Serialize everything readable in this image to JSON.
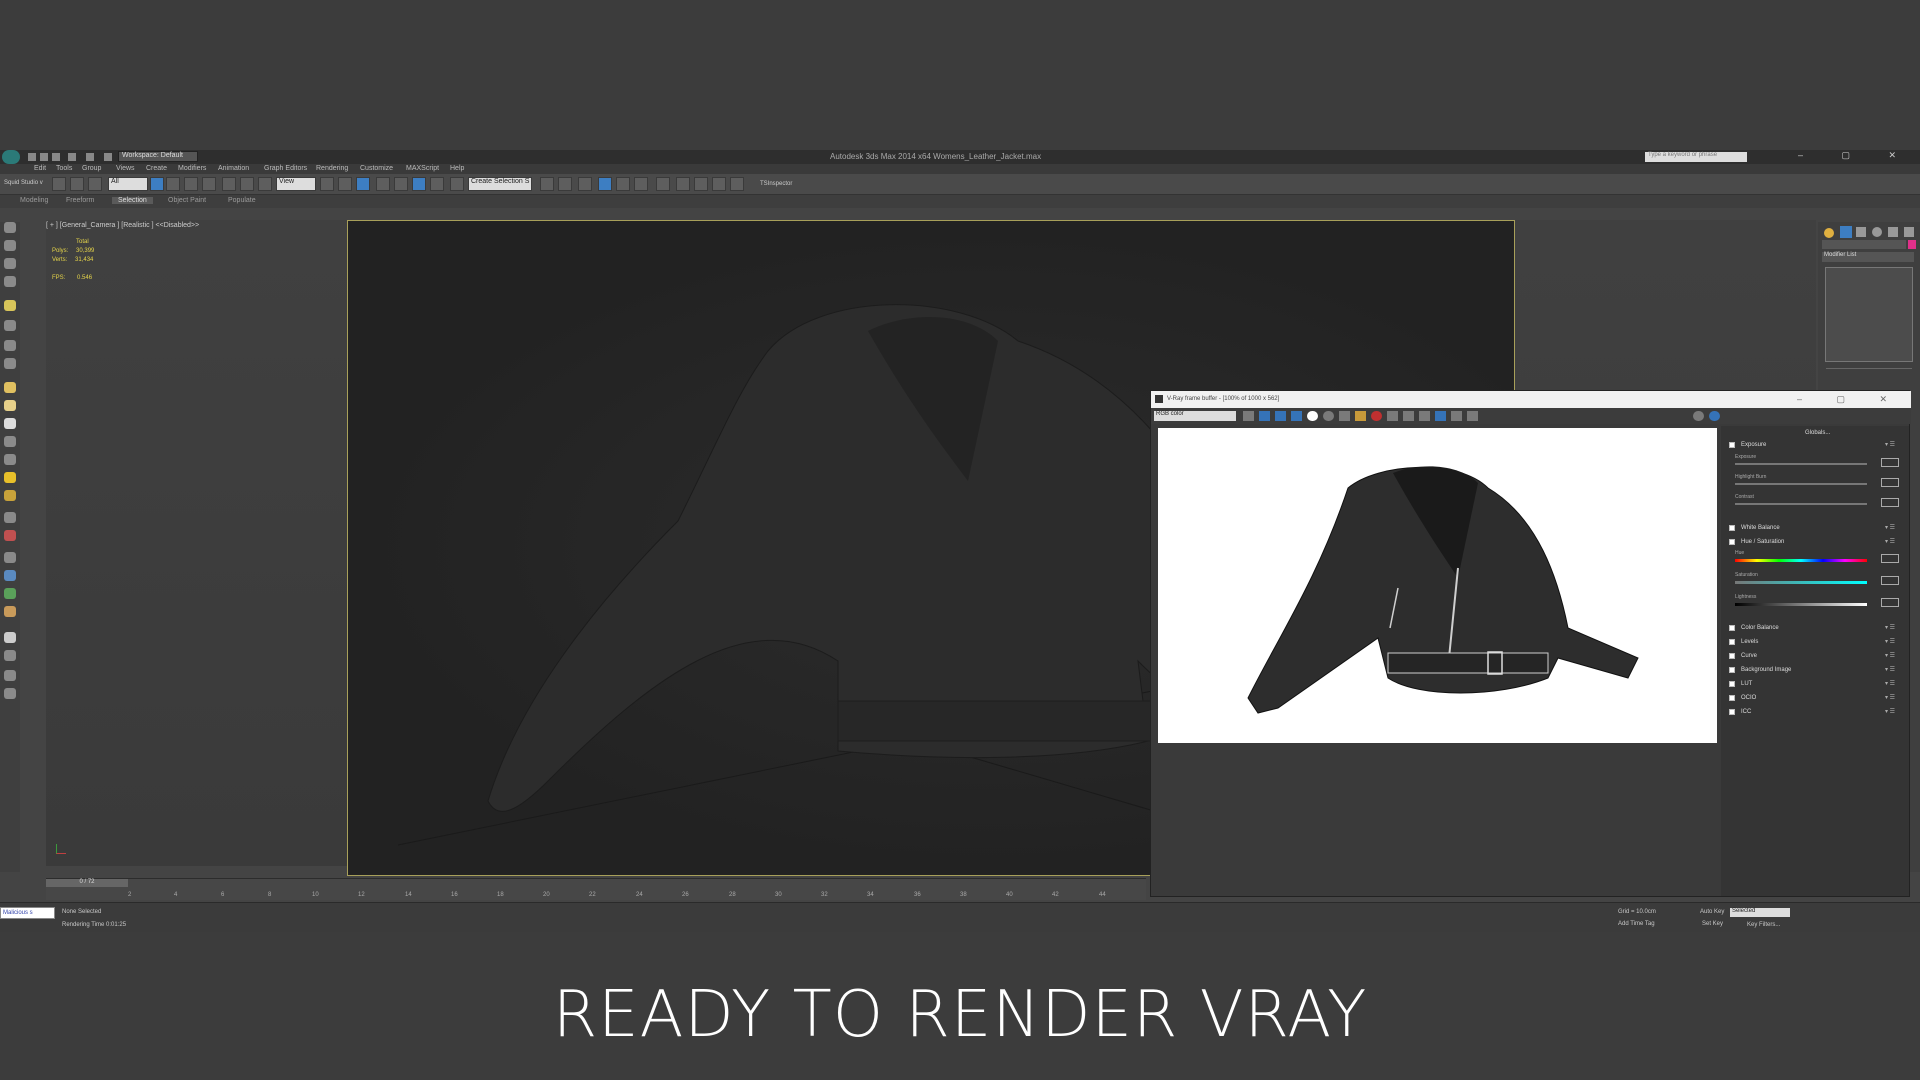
{
  "app": {
    "title": "Autodesk 3ds Max 2014 x64    Womens_Leather_Jacket.max",
    "workspace": "Workspace: Default",
    "search_placeholder": "Type a keyword or phrase"
  },
  "menu": [
    "Edit",
    "Tools",
    "Group",
    "Views",
    "Create",
    "Modifiers",
    "Animation",
    "Graph Editors",
    "Rendering",
    "Customize",
    "MAXScript",
    "Help"
  ],
  "toolbar": {
    "studio_label": "Squid Studio v",
    "filter_value": "All",
    "refcoord_value": "View",
    "selection_set": "Create Selection S",
    "plugin_label": "TSInspector"
  },
  "ribbon_tabs": [
    "Modeling",
    "Freeform",
    "Selection",
    "Object Paint",
    "Populate"
  ],
  "viewport": {
    "label": "[ + ] [General_Camera ] [Realistic ] <<Disabled>>",
    "stats": {
      "header": "Total",
      "polys_label": "Polys:",
      "polys": "30,399",
      "verts_label": "Verts:",
      "verts": "31,434",
      "fps_label": "FPS:",
      "fps": "0.546"
    }
  },
  "command_panel": {
    "modifier_list": "Modifier List"
  },
  "timeline": {
    "slider": "0 / 72",
    "ticks": [
      "2",
      "4",
      "6",
      "8",
      "10",
      "12",
      "14",
      "16",
      "18",
      "20",
      "22",
      "24",
      "26",
      "28",
      "30",
      "32",
      "34",
      "36",
      "38",
      "40",
      "42",
      "44"
    ]
  },
  "status": {
    "selection": "None Selected",
    "render_time": "Rendering Time  0:01:25",
    "grid": "Grid = 10.0cm",
    "auto_key": "Auto Key",
    "selected": "Selected",
    "set_key": "Set Key",
    "key_filters": "Key Filters...",
    "add_time_tag": "Add Time Tag",
    "maxscript": "Malicious s"
  },
  "vfb": {
    "title": "V-Ray frame buffer - [100% of 1000 x 562]",
    "channel": "RGB color",
    "globals": "Globals...",
    "sections": [
      "Exposure",
      "White Balance",
      "Hue / Saturation",
      "Color Balance",
      "Levels",
      "Curve",
      "Background Image",
      "LUT",
      "OCIO",
      "ICC"
    ],
    "exposure_sliders": [
      "Exposure",
      "Highlight Burn",
      "Contrast"
    ],
    "hue_sliders": [
      "Hue",
      "Saturation",
      "Lightness"
    ]
  },
  "caption": "READY TO RENDER  VRAY",
  "colors": {
    "accent": "#3d7ec2",
    "stats": "#e6d54a",
    "camera_frame": "#a8a05a"
  }
}
